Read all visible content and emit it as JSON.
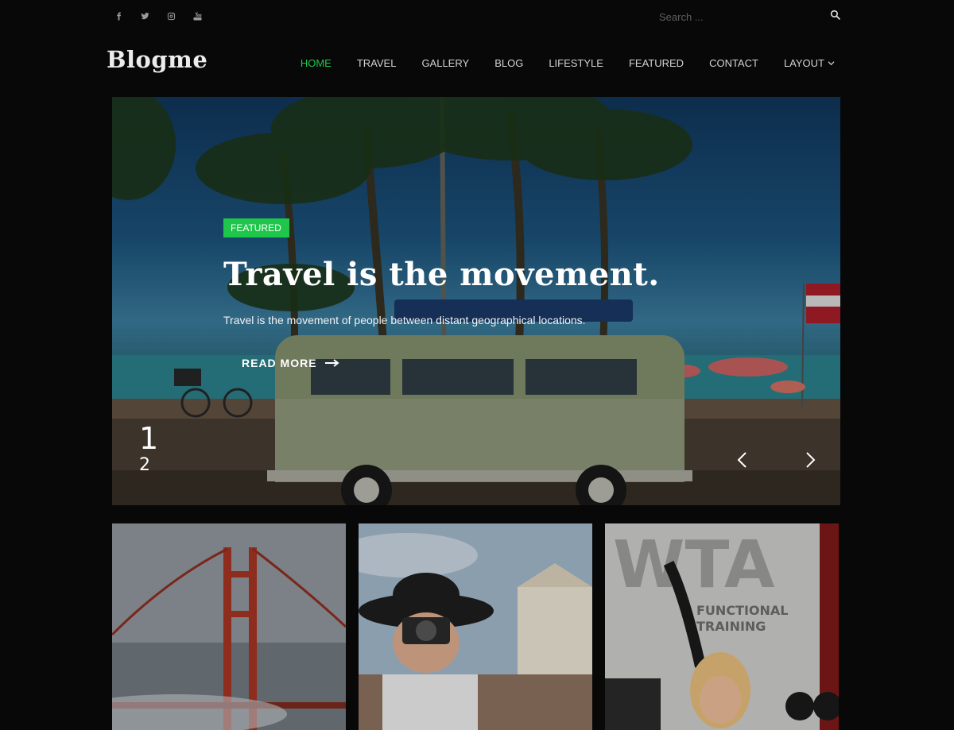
{
  "topbar": {
    "social_icons": [
      "facebook-icon",
      "twitter-icon",
      "instagram-icon",
      "youtube-icon"
    ],
    "search_placeholder": "Search ..."
  },
  "header": {
    "logo": "Blogme",
    "nav": [
      {
        "label": "HOME",
        "active": true
      },
      {
        "label": "TRAVEL"
      },
      {
        "label": "GALLERY"
      },
      {
        "label": "BLOG"
      },
      {
        "label": "LIFESTYLE"
      },
      {
        "label": "FEATURED"
      },
      {
        "label": "CONTACT"
      },
      {
        "label": "LAYOUT",
        "dropdown": true
      }
    ]
  },
  "hero": {
    "badge": "FEATURED",
    "title": "Travel is the movement.",
    "excerpt": "Travel is the movement of people between distant geographical locations.",
    "read_more": "READ MORE",
    "current_slide": "1",
    "next_slide": "2"
  },
  "cards": [
    {
      "image": "golden-gate-bridge"
    },
    {
      "image": "woman-with-camera"
    },
    {
      "image": "woman-training-gym"
    }
  ],
  "colors": {
    "accent": "#1ec64a",
    "background": "#080808"
  }
}
